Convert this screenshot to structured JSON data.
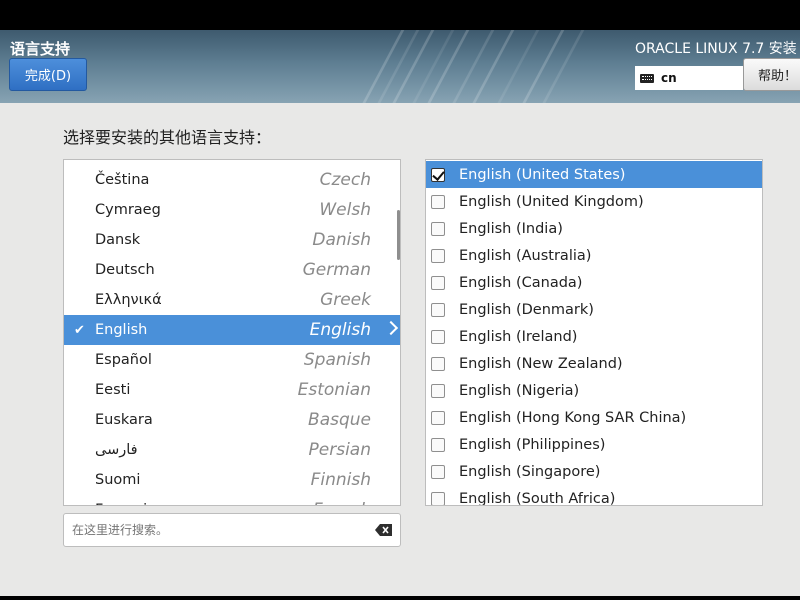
{
  "header": {
    "spoke_title": "语言支持",
    "done_label": "完成(D)",
    "product_title": "ORACLE LINUX 7.7 安装",
    "keyboard_layout": "cn",
    "help_label": "帮助！"
  },
  "prompt": "选择要安装的其他语言支持：",
  "languages": [
    {
      "native": "Čeština",
      "english": "Czech",
      "selected": false
    },
    {
      "native": "Cymraeg",
      "english": "Welsh",
      "selected": false
    },
    {
      "native": "Dansk",
      "english": "Danish",
      "selected": false
    },
    {
      "native": "Deutsch",
      "english": "German",
      "selected": false
    },
    {
      "native": "Ελληνικά",
      "english": "Greek",
      "selected": false
    },
    {
      "native": "English",
      "english": "English",
      "selected": true
    },
    {
      "native": "Español",
      "english": "Spanish",
      "selected": false
    },
    {
      "native": "Eesti",
      "english": "Estonian",
      "selected": false
    },
    {
      "native": "Euskara",
      "english": "Basque",
      "selected": false
    },
    {
      "native": "فارسی",
      "english": "Persian",
      "selected": false
    },
    {
      "native": "Suomi",
      "english": "Finnish",
      "selected": false
    },
    {
      "native": "Français",
      "english": "French",
      "selected": false
    }
  ],
  "search": {
    "placeholder": "在这里进行搜索。"
  },
  "locales": [
    {
      "label": "English (United States)",
      "checked": true
    },
    {
      "label": "English (United Kingdom)",
      "checked": false
    },
    {
      "label": "English (India)",
      "checked": false
    },
    {
      "label": "English (Australia)",
      "checked": false
    },
    {
      "label": "English (Canada)",
      "checked": false
    },
    {
      "label": "English (Denmark)",
      "checked": false
    },
    {
      "label": "English (Ireland)",
      "checked": false
    },
    {
      "label": "English (New Zealand)",
      "checked": false
    },
    {
      "label": "English (Nigeria)",
      "checked": false
    },
    {
      "label": "English (Hong Kong SAR China)",
      "checked": false
    },
    {
      "label": "English (Philippines)",
      "checked": false
    },
    {
      "label": "English (Singapore)",
      "checked": false
    },
    {
      "label": "English (South Africa)",
      "checked": false
    }
  ]
}
